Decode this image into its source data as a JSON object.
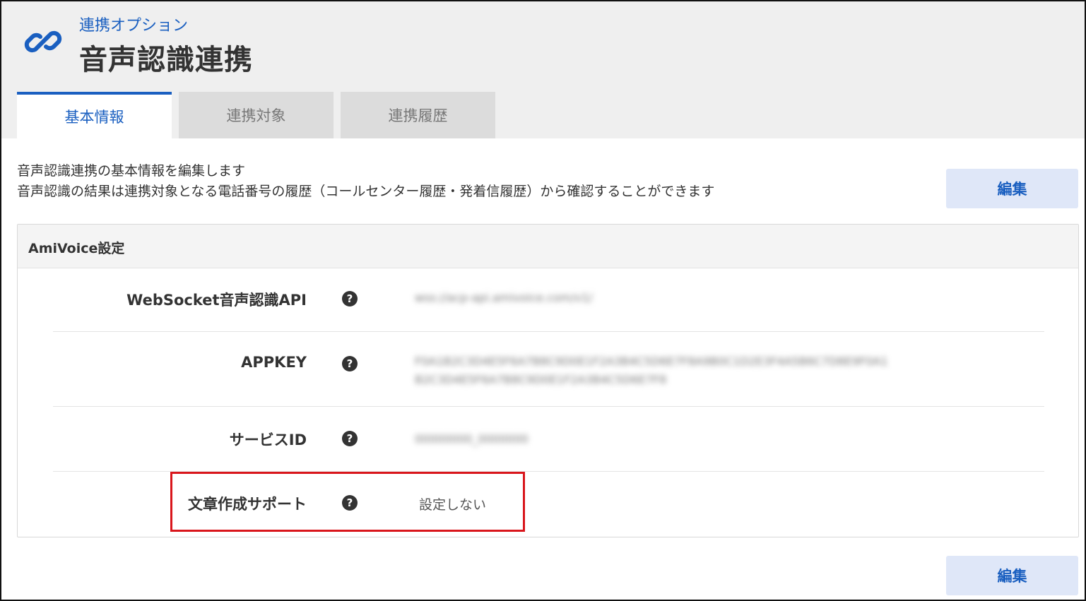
{
  "header": {
    "subtitle": "連携オプション",
    "title": "音声認識連携",
    "icon": "link-icon"
  },
  "tabs": [
    {
      "label": "基本情報",
      "active": true
    },
    {
      "label": "連携対象",
      "active": false
    },
    {
      "label": "連携履歴",
      "active": false
    }
  ],
  "description": {
    "line1": "音声認識連携の基本情報を編集します",
    "line2": "音声認識の結果は連携対象となる電話番号の履歴（コールセンター履歴・発着信履歴）から確認することができます"
  },
  "actions": {
    "edit_label": "編集"
  },
  "panel": {
    "title": "AmiVoice設定",
    "rows": [
      {
        "label": "WebSocket音声認識API",
        "value": "wss://acp-api.amivoice.com/v1/",
        "blurred": true
      },
      {
        "label": "APPKEY",
        "value": "F0A1B2C3D4E5F6A7B8C9D0E1F2A3B4C5D6E7F8A9B0C1D2E3F4A5B6C7D8E9F0A1",
        "value2": "B2C3D4E5F6A7B8C9D0E1F2A3B4C5D6E7F8",
        "blurred": true
      },
      {
        "label": "サービスID",
        "value": "00000000_0000000",
        "blurred": true
      },
      {
        "label": "文章作成サポート",
        "value": "設定しない",
        "blurred": false
      }
    ],
    "help_glyph": "?"
  },
  "colors": {
    "accent": "#1a5fc0",
    "highlight": "#d9161c"
  }
}
